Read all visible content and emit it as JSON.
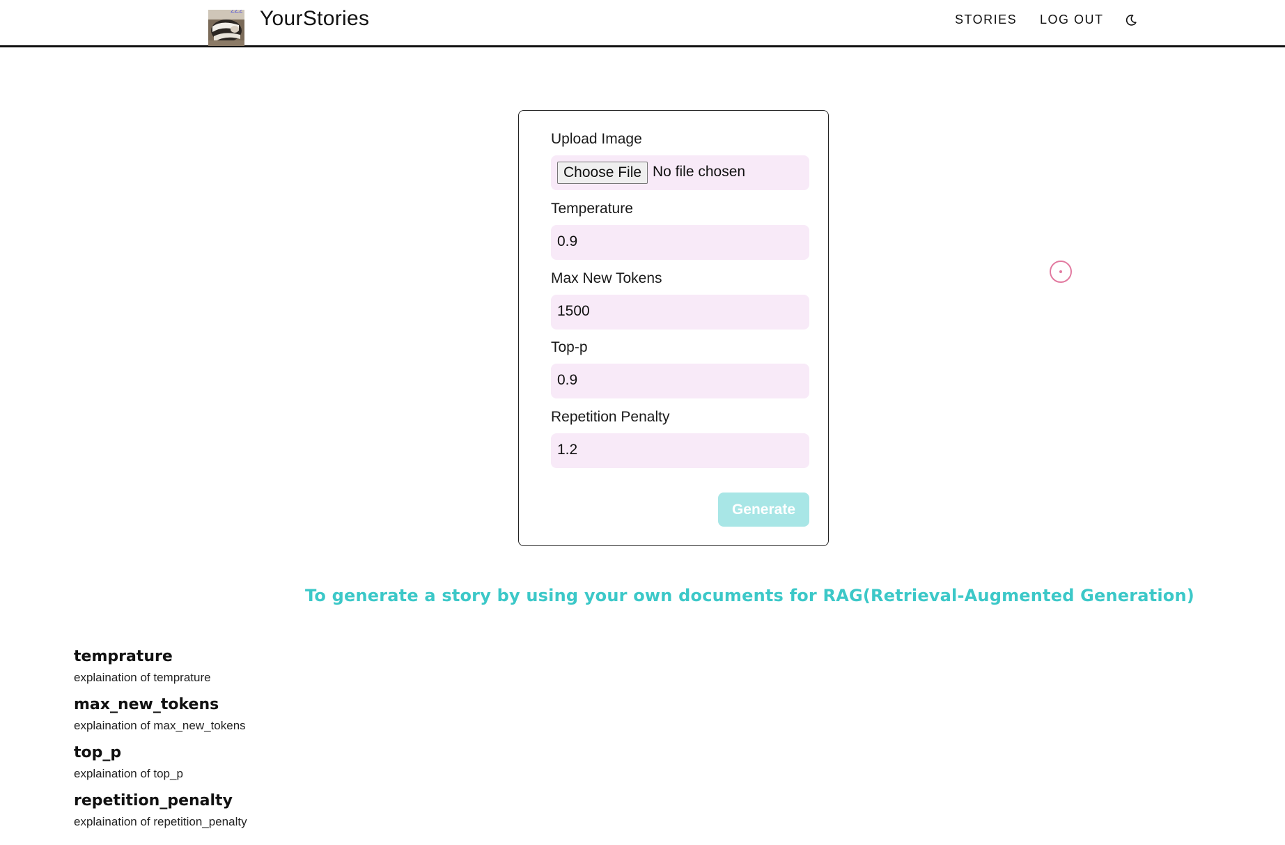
{
  "header": {
    "brand": "YourStories",
    "logo_zz": "zZz",
    "nav": {
      "stories": "STORIES",
      "logout": "LOG OUT"
    }
  },
  "form": {
    "upload": {
      "label": "Upload Image",
      "button": "Choose File",
      "status": "No file chosen"
    },
    "temperature": {
      "label": "Temperature",
      "value": "0.9"
    },
    "max_new_tokens": {
      "label": "Max New Tokens",
      "value": "1500"
    },
    "top_p": {
      "label": "Top-p",
      "value": "0.9"
    },
    "repetition_penalty": {
      "label": "Repetition Penalty",
      "value": "1.2"
    },
    "generate": "Generate"
  },
  "rag_link": "To generate a story by using your own documents for RAG(Retrieval-Augmented Generation)",
  "params": [
    {
      "name": "temprature",
      "desc": "explaination of temprature"
    },
    {
      "name": "max_new_tokens",
      "desc": "explaination of max_new_tokens"
    },
    {
      "name": "top_p",
      "desc": "explaination of top_p"
    },
    {
      "name": "repetition_penalty",
      "desc": "explaination of repetition_penalty"
    }
  ],
  "colors": {
    "field_bg": "#f8eaf8",
    "generate_bg": "#a8e6e6",
    "rag_link": "#3cc8c8",
    "cursor": "#e27aa0"
  },
  "icons": {
    "theme": "moon-icon",
    "logo": "sleeping-cat-logo",
    "cursor": "cursor-ring-icon"
  }
}
